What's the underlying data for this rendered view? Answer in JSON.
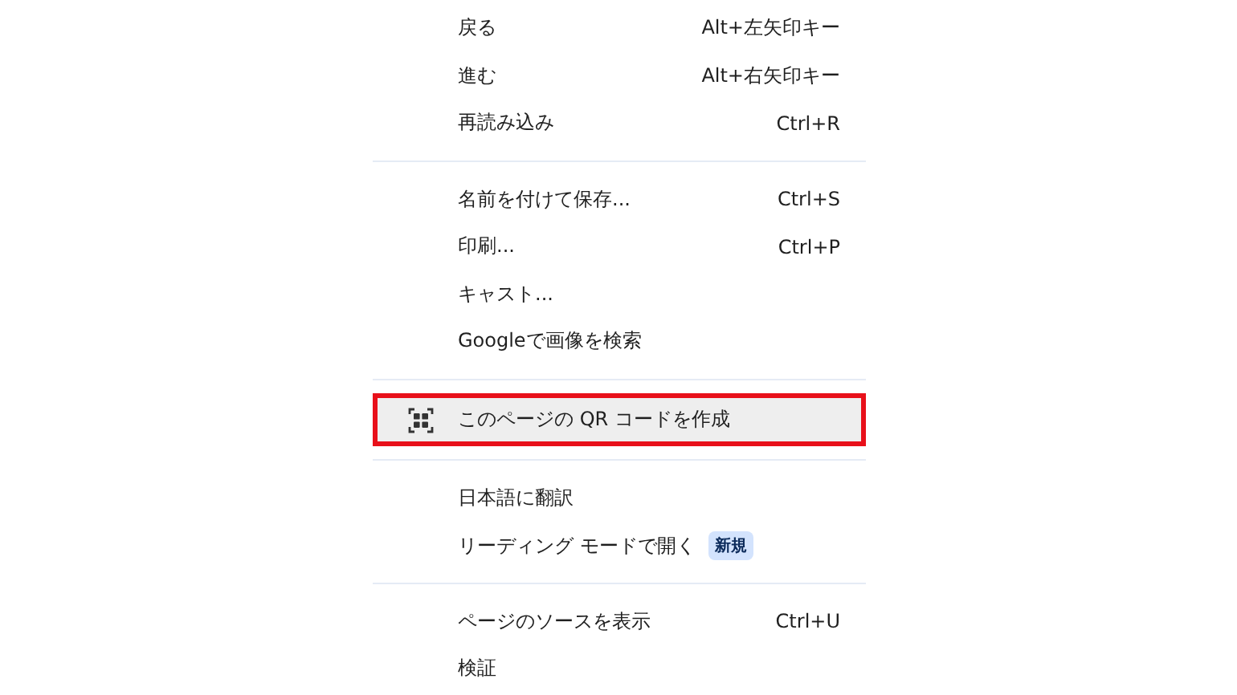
{
  "menu": {
    "sections": [
      {
        "items": [
          {
            "label": "戻る",
            "shortcut": "Alt+左矢印キー",
            "highlighted": false
          },
          {
            "label": "進む",
            "shortcut": "Alt+右矢印キー",
            "highlighted": false
          },
          {
            "label": "再読み込み",
            "shortcut": "Ctrl+R",
            "highlighted": false
          }
        ]
      },
      {
        "items": [
          {
            "label": "名前を付けて保存...",
            "shortcut": "Ctrl+S",
            "highlighted": false
          },
          {
            "label": "印刷...",
            "shortcut": "Ctrl+P",
            "highlighted": false
          },
          {
            "label": "キャスト...",
            "highlighted": false
          },
          {
            "label": "Googleで画像を検索",
            "highlighted": false
          }
        ]
      },
      {
        "items": [
          {
            "label": "このページの QR コードを作成",
            "kind": "qr",
            "highlighted": true
          }
        ]
      },
      {
        "items": [
          {
            "label": "日本語に翻訳",
            "highlighted": false
          },
          {
            "label": "リーディング モードで開く",
            "badge": "新規",
            "highlighted": false
          }
        ]
      },
      {
        "items": [
          {
            "label": "ページのソースを表示",
            "shortcut": "Ctrl+U",
            "highlighted": false
          },
          {
            "label": "検証",
            "highlighted": false
          }
        ]
      }
    ]
  }
}
